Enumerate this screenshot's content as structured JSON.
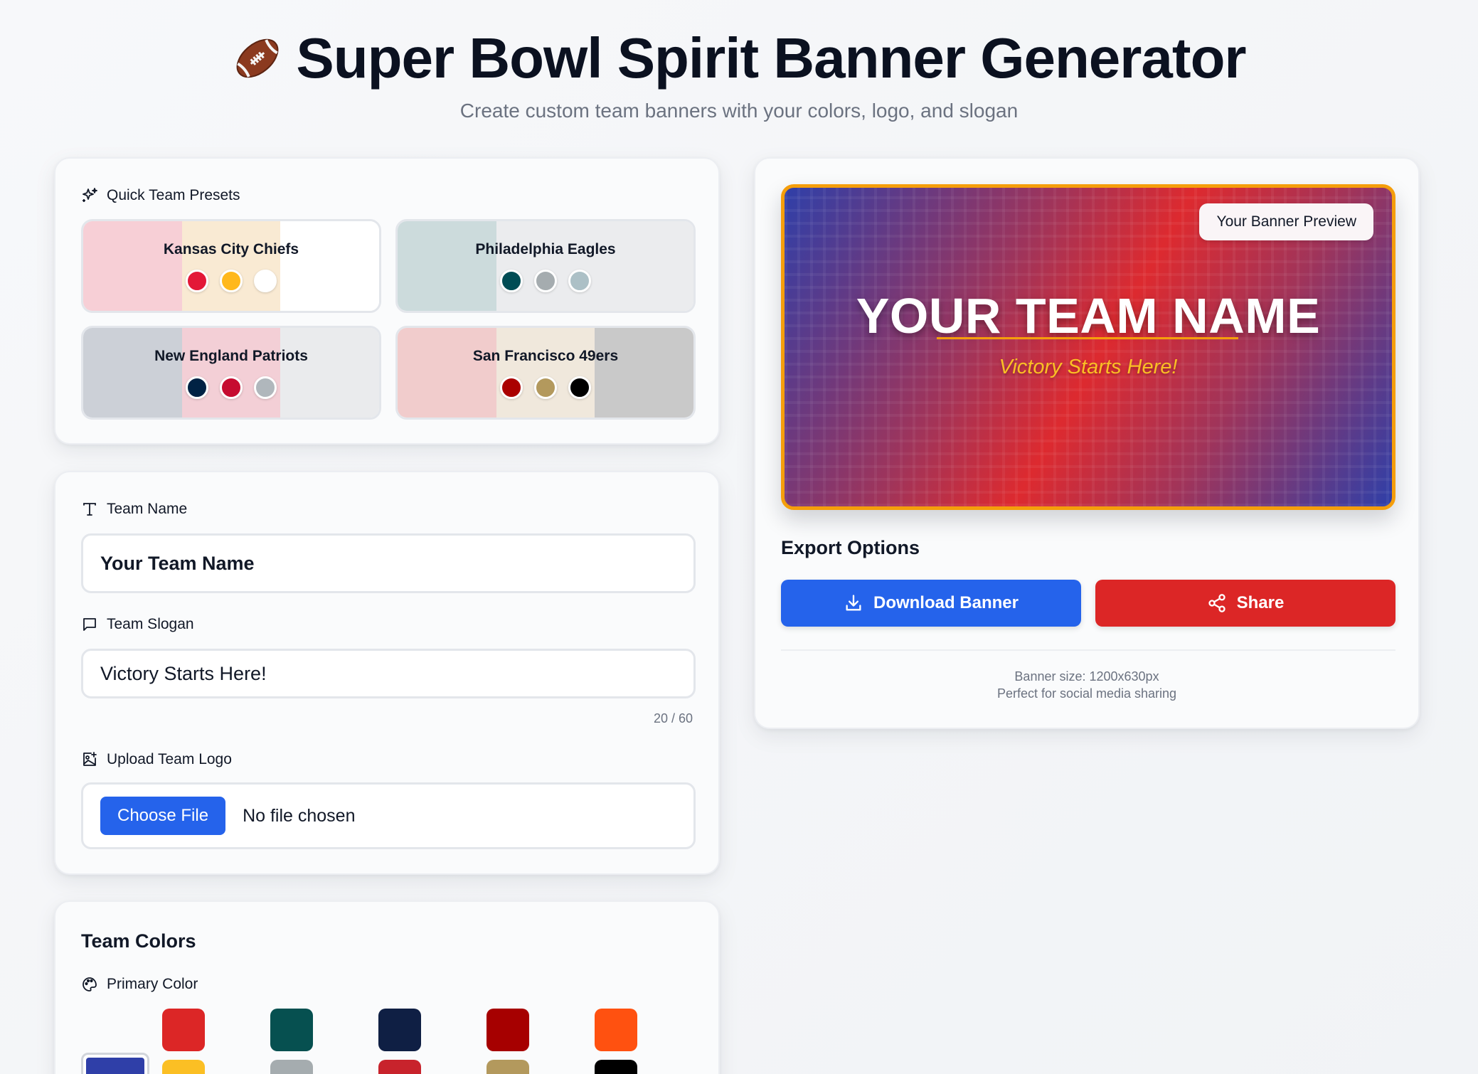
{
  "header": {
    "title": "Super Bowl Spirit Banner Generator",
    "subtitle": "Create custom team banners with your colors, logo, and slogan"
  },
  "presets": {
    "label": "Quick Team Presets",
    "items": [
      {
        "name": "Kansas City Chiefs",
        "colors": [
          "#e31837",
          "#ffb81c",
          "#ffffff"
        ]
      },
      {
        "name": "Philadelphia Eagles",
        "colors": [
          "#004c54",
          "#a5acaf",
          "#acc0c6"
        ]
      },
      {
        "name": "New England Patriots",
        "colors": [
          "#002244",
          "#c60c30",
          "#b0b7bc"
        ]
      },
      {
        "name": "San Francisco 49ers",
        "colors": [
          "#aa0000",
          "#b3995d",
          "#000000"
        ]
      }
    ]
  },
  "form": {
    "team_name_label": "Team Name",
    "team_name_value": "Your Team Name",
    "slogan_label": "Team Slogan",
    "slogan_value": "Victory Starts Here!",
    "slogan_counter": "20 / 60",
    "logo_label": "Upload Team Logo",
    "choose_file": "Choose File",
    "no_file": "No file chosen"
  },
  "colors": {
    "title": "Team Colors",
    "primary_label": "Primary Color",
    "selected": "#2f3fa8",
    "palette_top": [
      "#dc2626",
      "#065050",
      "#0f1f44",
      "#a60000",
      "#ff5110"
    ],
    "palette_bottom": [
      "#fbbf24",
      "#a5acaf",
      "#c8232c",
      "#b3995d",
      "#000000"
    ]
  },
  "preview": {
    "badge": "Your Banner Preview",
    "team_name": "YOUR TEAM NAME",
    "slogan": "Victory Starts Here!"
  },
  "export": {
    "title": "Export Options",
    "download_label": "Download Banner",
    "share_label": "Share",
    "size_text": "Banner size: 1200x630px",
    "note": "Perfect for social media sharing"
  }
}
